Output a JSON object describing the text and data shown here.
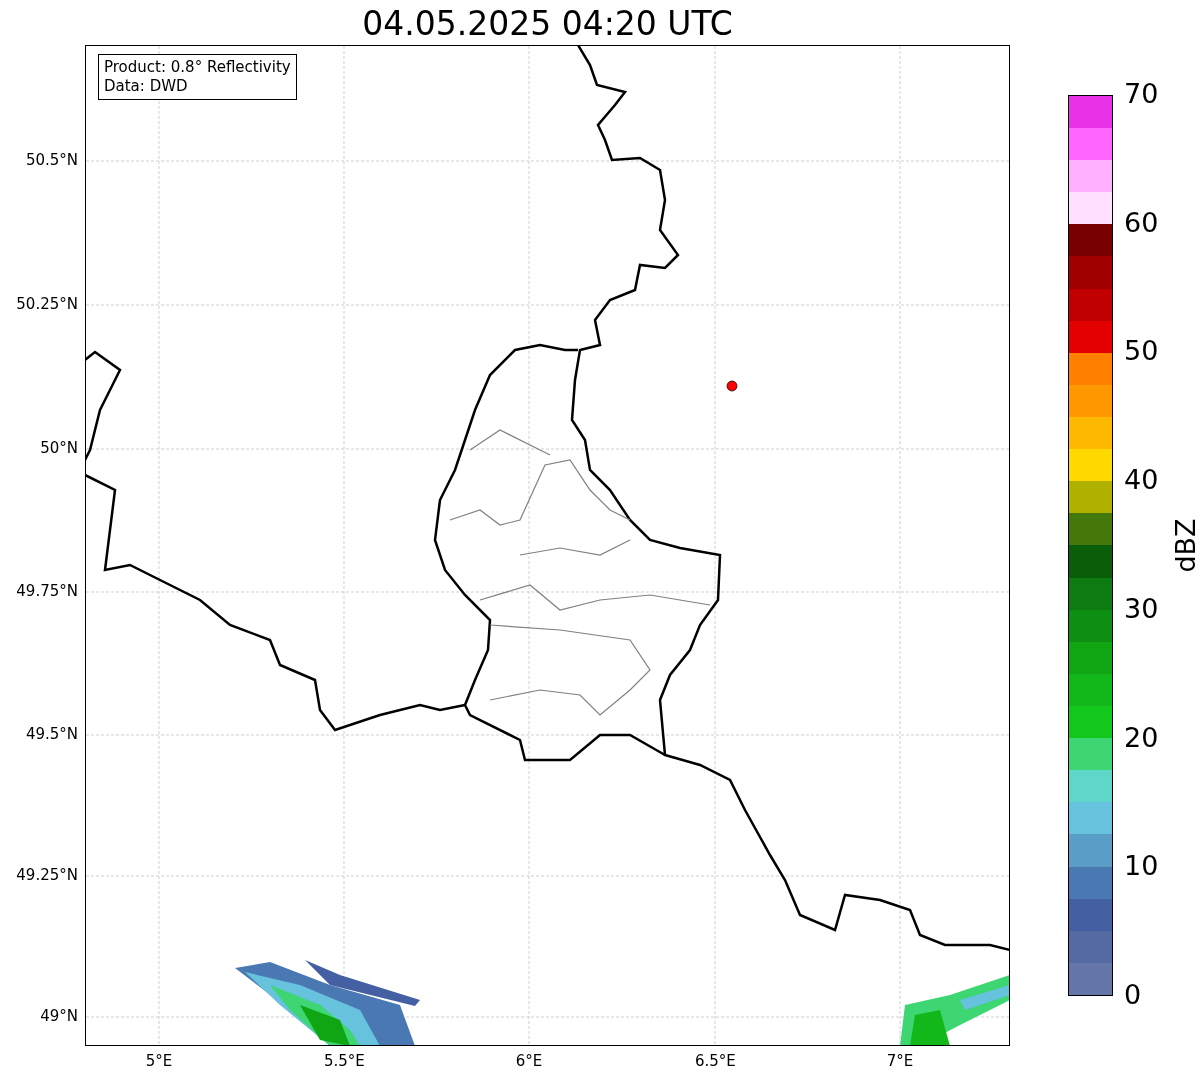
{
  "title": "04.05.2025 04:20 UTC",
  "info_box": [
    "Product: 0.8° Reflectivity",
    "Data: DWD"
  ],
  "latitude_ticks": [
    "50.5°N",
    "50.25°N",
    "50°N",
    "49.75°N",
    "49.5°N",
    "49.25°N",
    "49°N"
  ],
  "longitude_ticks": [
    "5°E",
    "5.5°E",
    "6°E",
    "6.5°E",
    "7°E"
  ],
  "colorbar": {
    "label": "dBZ",
    "ticks": [
      "70",
      "60",
      "50",
      "40",
      "30",
      "20",
      "10",
      "0"
    ],
    "bins": [
      {
        "color": "#6577a8"
      },
      {
        "color": "#556aa3"
      },
      {
        "color": "#4460a3"
      },
      {
        "color": "#4a78b3"
      },
      {
        "color": "#5a9ec8"
      },
      {
        "color": "#66c2dd"
      },
      {
        "color": "#5fd7c8"
      },
      {
        "color": "#3dd672"
      },
      {
        "color": "#12c81a"
      },
      {
        "color": "#12b81a"
      },
      {
        "color": "#10a513"
      },
      {
        "color": "#0f8e14"
      },
      {
        "color": "#0e7a12"
      },
      {
        "color": "#0a5e0a"
      },
      {
        "color": "#45780a"
      },
      {
        "color": "#b0b000"
      },
      {
        "color": "#ffd800"
      },
      {
        "color": "#ffb800"
      },
      {
        "color": "#ff9800"
      },
      {
        "color": "#ff7f00"
      },
      {
        "color": "#e50000"
      },
      {
        "color": "#c00000"
      },
      {
        "color": "#a00000"
      },
      {
        "color": "#780000"
      },
      {
        "color": "#ffe0ff"
      },
      {
        "color": "#ffb0ff"
      },
      {
        "color": "#ff66ff"
      },
      {
        "color": "#e832e8"
      }
    ]
  }
}
